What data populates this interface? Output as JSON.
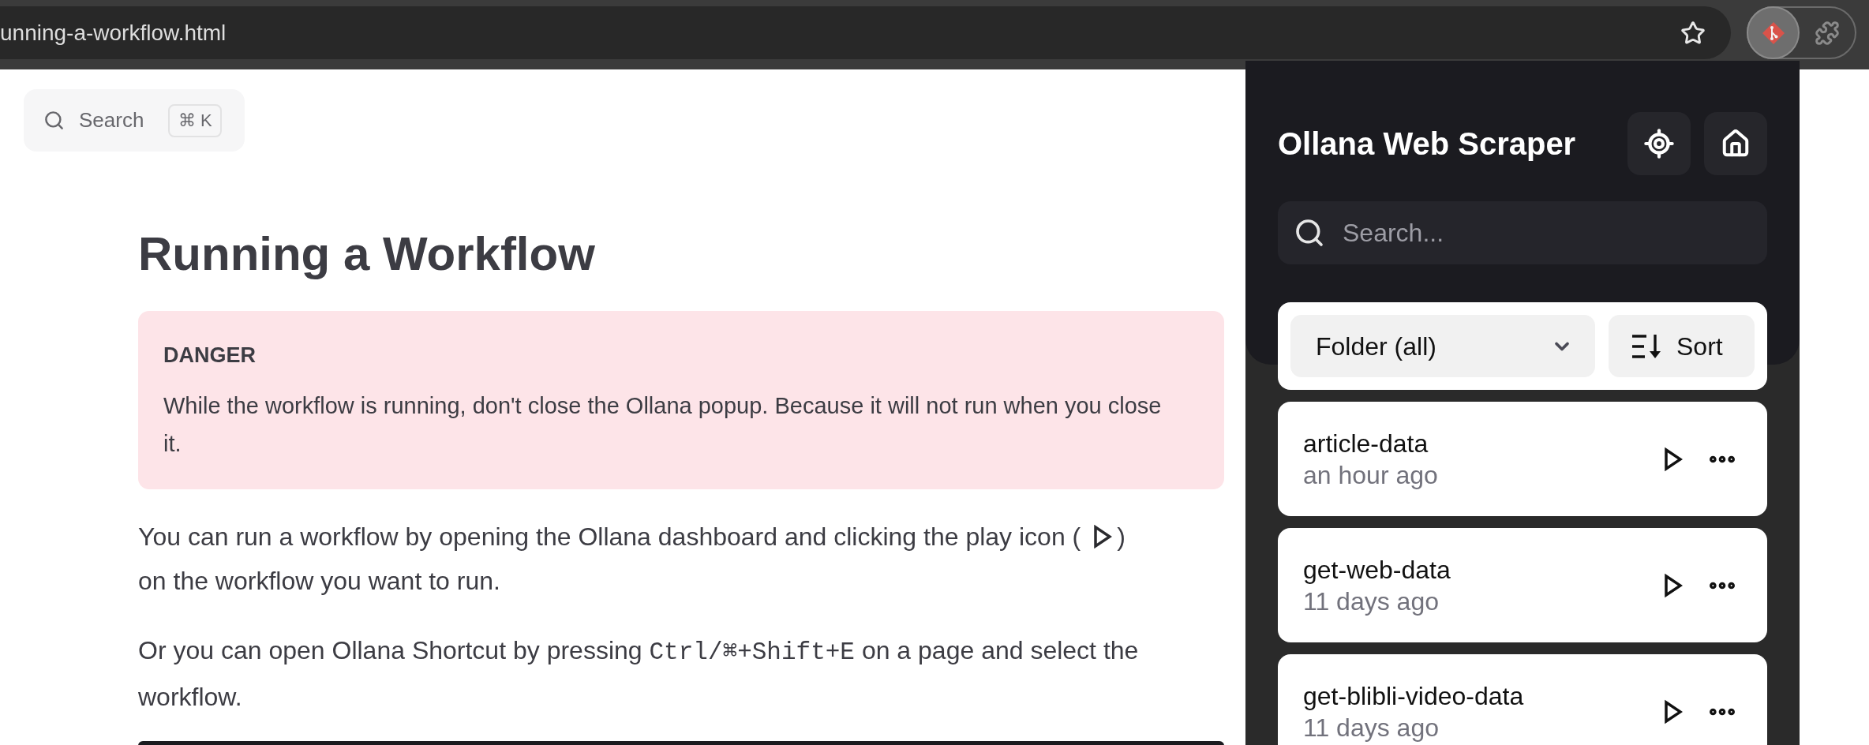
{
  "browser": {
    "url": "unning-a-workflow.html"
  },
  "docs": {
    "search": {
      "label": "Search",
      "shortcut": "⌘ K"
    },
    "title": "Running a Workflow",
    "callout": {
      "kind": "danger",
      "title": "DANGER",
      "text": "While the workflow is running, don't close the Ollana popup. Because it will not run when you close it."
    },
    "paragraphs": [
      {
        "parts": [
          {
            "kind": "text",
            "text": "You can run a workflow by opening the Ollana dashboard and clicking the play icon ("
          },
          {
            "kind": "icon"
          },
          {
            "kind": "text",
            "text": ") on the workflow you want to run."
          }
        ]
      },
      {
        "parts": [
          {
            "kind": "text",
            "text": "Or you can open Ollana Shortcut by pressing "
          },
          {
            "kind": "code",
            "text": "Ctrl/⌘+Shift+E"
          },
          {
            "kind": "text",
            "text": " on a page and select the workflow."
          }
        ]
      }
    ]
  },
  "popup": {
    "title": "Ollana Web Scraper",
    "search": {
      "placeholder": "Search..."
    },
    "folder_select": {
      "value": "Folder (all)"
    },
    "sort_button": {
      "label": "Sort"
    },
    "workflows": [
      {
        "name": "article-data",
        "updated": "an hour ago"
      },
      {
        "name": "get-web-data",
        "updated": "11 days ago"
      },
      {
        "name": "get-blibli-video-data",
        "updated": "11 days ago"
      }
    ]
  }
}
